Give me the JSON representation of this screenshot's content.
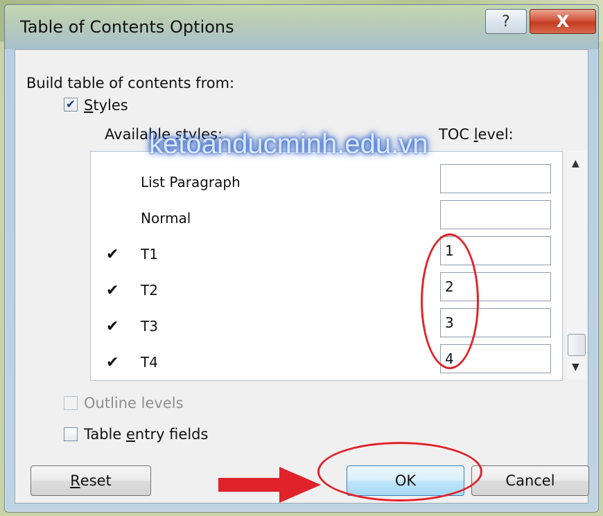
{
  "dialog": {
    "title": "Table of Contents Options",
    "help_glyph": "?",
    "close_glyph": "X"
  },
  "build_from": {
    "heading": "Build table of contents from:",
    "styles_checkbox": {
      "label_prefix": "",
      "label_underline": "S",
      "label_rest": "tyles",
      "checked": true
    },
    "available_styles_header": "Available styles:",
    "toc_level_header_prefix": "TOC ",
    "toc_level_header_underline": "l",
    "toc_level_header_rest": "evel:"
  },
  "styles_list": [
    {
      "checked_glyph": "",
      "name": "List Paragraph",
      "toc_level": ""
    },
    {
      "checked_glyph": "",
      "name": "Normal",
      "toc_level": ""
    },
    {
      "checked_glyph": "✔",
      "name": "T1",
      "toc_level": "1"
    },
    {
      "checked_glyph": "✔",
      "name": "T2",
      "toc_level": "2"
    },
    {
      "checked_glyph": "✔",
      "name": "T3",
      "toc_level": "3"
    },
    {
      "checked_glyph": "✔",
      "name": "T4",
      "toc_level": "4"
    }
  ],
  "scrollbar": {
    "up_glyph": "▲",
    "down_glyph": "▼"
  },
  "watermark": "ketoanducminh.edu.vn",
  "outline_levels": {
    "label": "Outline levels",
    "enabled": false,
    "checked": false
  },
  "table_entry_fields": {
    "label_prefix": "Table ",
    "label_underline": "e",
    "label_rest": "ntry fields",
    "checked": false
  },
  "buttons": {
    "reset_underline": "R",
    "reset_rest": "eset",
    "ok": "OK",
    "cancel": "Cancel"
  },
  "colors": {
    "annotation": "#e0232b",
    "accent": "#3c7fb1"
  }
}
